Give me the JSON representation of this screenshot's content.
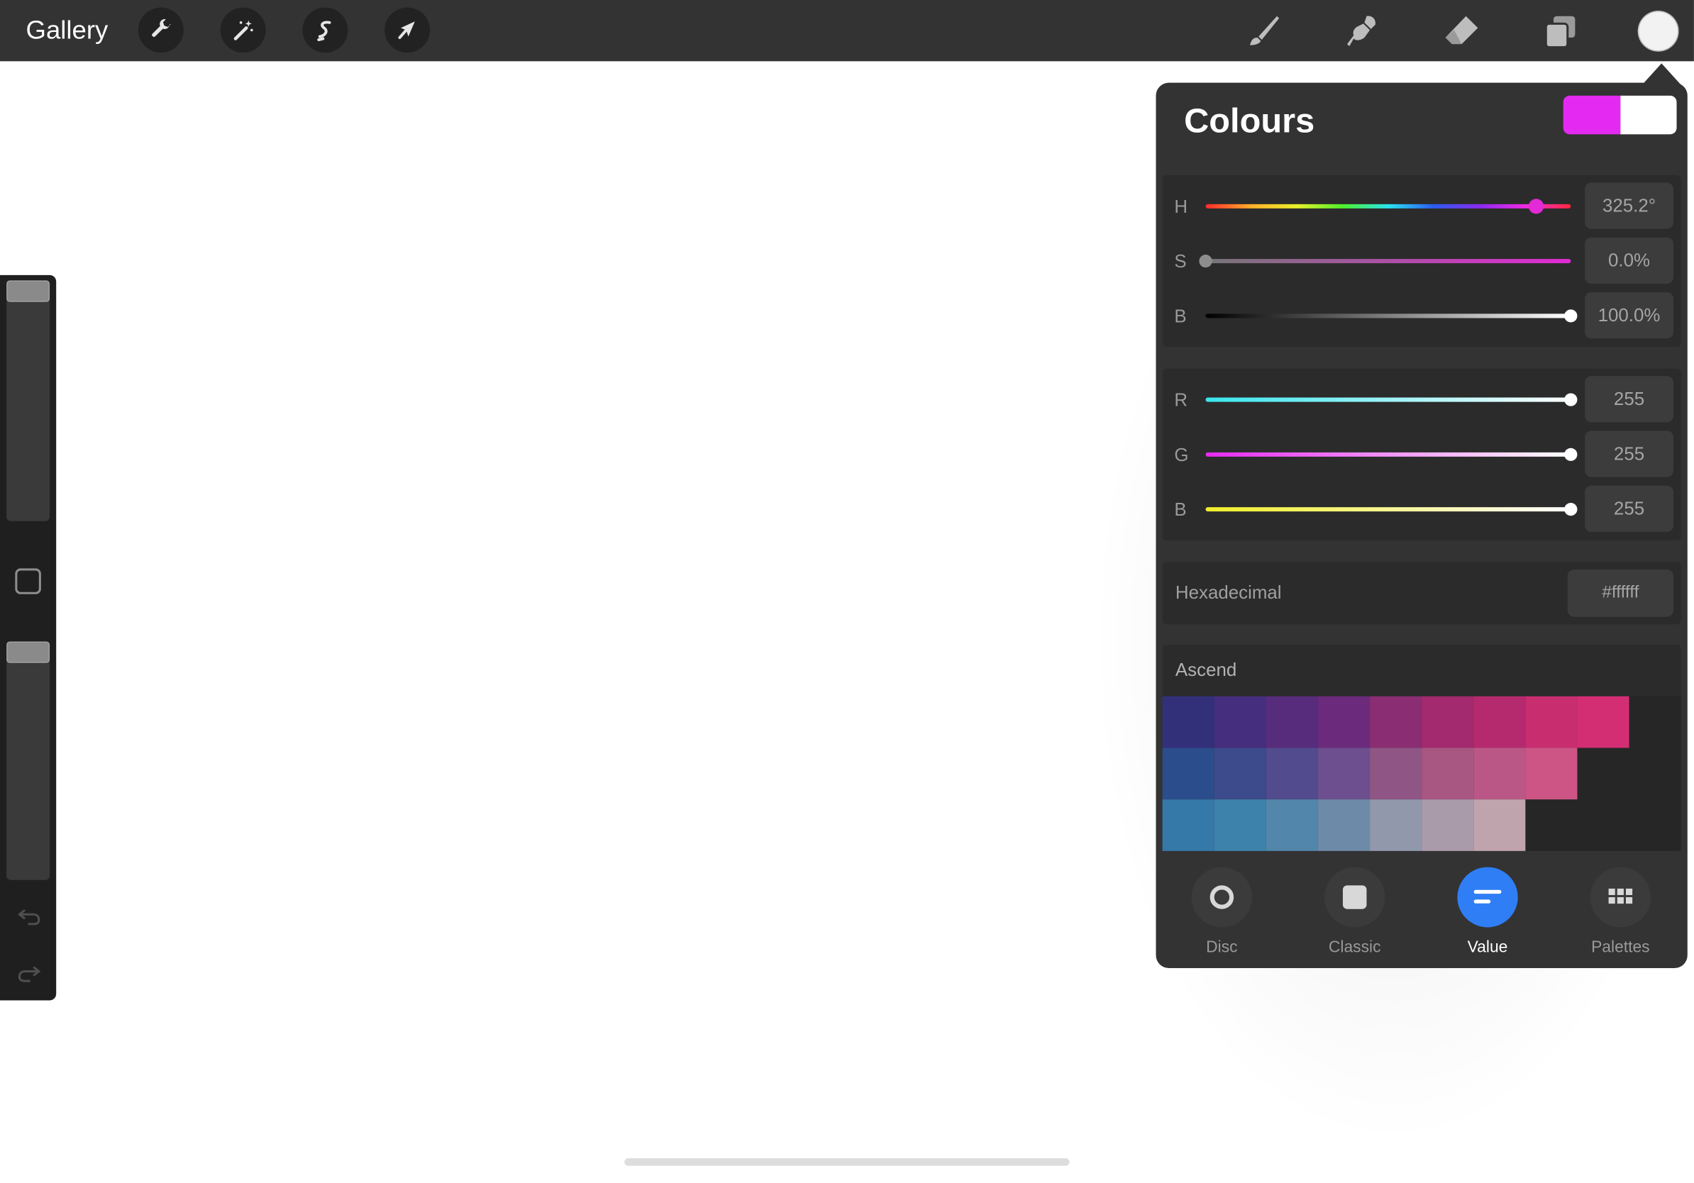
{
  "topbar": {
    "gallery_label": "Gallery",
    "left_tools": [
      "wrench-icon",
      "magic-wand-icon",
      "selection-icon",
      "transform-arrow-icon"
    ],
    "right_tools": [
      "brush-icon",
      "smudge-icon",
      "eraser-icon",
      "layers-icon"
    ],
    "current_color": "#f2f2f2"
  },
  "sidebar": {
    "brush_size_level": 1.0,
    "opacity_level": 1.0
  },
  "colours_panel": {
    "title": "Colours",
    "primary_swatch": "#e429f2",
    "secondary_swatch": "#ffffff",
    "hsb": [
      {
        "label": "H",
        "value": "325.2°",
        "fraction": 0.904
      },
      {
        "label": "S",
        "value": "0.0%",
        "fraction": 0.0
      },
      {
        "label": "B",
        "value": "100.0%",
        "fraction": 1.0
      }
    ],
    "rgb": [
      {
        "label": "R",
        "value": "255",
        "fraction": 1.0
      },
      {
        "label": "G",
        "value": "255",
        "fraction": 1.0
      },
      {
        "label": "B",
        "value": "255",
        "fraction": 1.0
      }
    ],
    "hex_label": "Hexadecimal",
    "hex_value": "#ffffff",
    "palette": {
      "name": "Ascend",
      "rows": [
        [
          "#33307a",
          "#452e7e",
          "#582c7c",
          "#6c2a7c",
          "#8a2d72",
          "#a32a6e",
          "#b52a6e",
          "#c82d70",
          "#d32e73"
        ],
        [
          "#2c4d8b",
          "#3d4a8c",
          "#524b8d",
          "#6d4e8f",
          "#8f5584",
          "#a85682",
          "#bb5787",
          "#cc5585"
        ],
        [
          "#3579a9",
          "#3d82aa",
          "#5286aa",
          "#6d8aa8",
          "#9198ac",
          "#aa9bab",
          "#c0a4ad"
        ]
      ]
    },
    "tabs": [
      {
        "label": "Disc",
        "icon": "disc-icon",
        "active": false
      },
      {
        "label": "Classic",
        "icon": "square-icon",
        "active": false
      },
      {
        "label": "Value",
        "icon": "value-lines-icon",
        "active": true
      },
      {
        "label": "Palettes",
        "icon": "grid-icon",
        "active": false
      }
    ]
  }
}
